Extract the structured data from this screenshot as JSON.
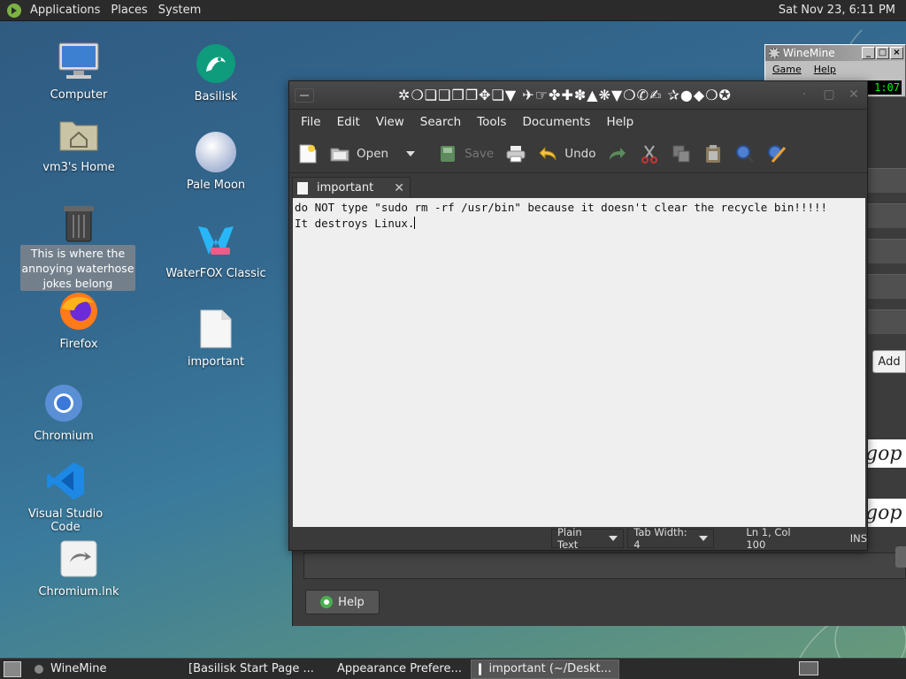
{
  "top_panel": {
    "menus": [
      "Applications",
      "Places",
      "System"
    ],
    "clock": "Sat Nov 23,  6:11 PM"
  },
  "desktop": {
    "icons": [
      {
        "label": "Computer",
        "icon": "computer-icon"
      },
      {
        "label": "vm3's Home",
        "icon": "home-folder-icon"
      },
      {
        "label": "Trash",
        "icon": "trash-icon"
      },
      {
        "label": "Firefox",
        "icon": "firefox-icon"
      },
      {
        "label": "Chromium",
        "icon": "chromium-icon"
      },
      {
        "label": "Visual Studio Code",
        "icon": "vscode-icon"
      },
      {
        "label": "Chromium.lnk",
        "icon": "shortcut-icon"
      },
      {
        "label": "Basilisk",
        "icon": "basilisk-icon"
      },
      {
        "label": "Pale Moon",
        "icon": "palemoon-icon"
      },
      {
        "label": "WaterFOX Classic",
        "icon": "waterfox-icon"
      },
      {
        "label": "important",
        "icon": "text-file-icon"
      }
    ],
    "tooltip": "This is where the annoying waterhose jokes belong"
  },
  "winemine": {
    "title": "WineMine",
    "menu": [
      "Game",
      "Help"
    ],
    "counter": "1:07"
  },
  "appearance_window": {
    "add_label": "Add",
    "preview_text": "gop",
    "help_label": "Help"
  },
  "editor": {
    "title": "✲❍❏❑❒❐✥❏▼ ✈☞✤✚✽▲❋▼❍✆✍ ✰●◆❍✪",
    "menus": [
      "File",
      "Edit",
      "View",
      "Search",
      "Tools",
      "Documents",
      "Help"
    ],
    "toolbar": {
      "open": "Open",
      "save": "Save",
      "undo": "Undo"
    },
    "tab": {
      "label": "important"
    },
    "content_lines": [
      "do NOT type \"sudo rm -rf /usr/bin\" because it doesn't clear the recycle bin!!!!!",
      "It destroys Linux."
    ],
    "status": {
      "language": "Plain Text",
      "tab_width": "Tab Width:  4",
      "position": "Ln 1, Col 100",
      "mode": "INS"
    }
  },
  "taskbar": {
    "tasks": [
      {
        "label": "WineMine"
      },
      {
        "label": "[Basilisk Start Page ..."
      },
      {
        "label": "Appearance Prefere..."
      },
      {
        "label": "important (~/Deskt..."
      }
    ]
  },
  "colors": {
    "panel": "#2b2b2b",
    "editor_bg": "#3a3a3a",
    "text_area": "#efefef",
    "mint_green": "#7db343"
  }
}
